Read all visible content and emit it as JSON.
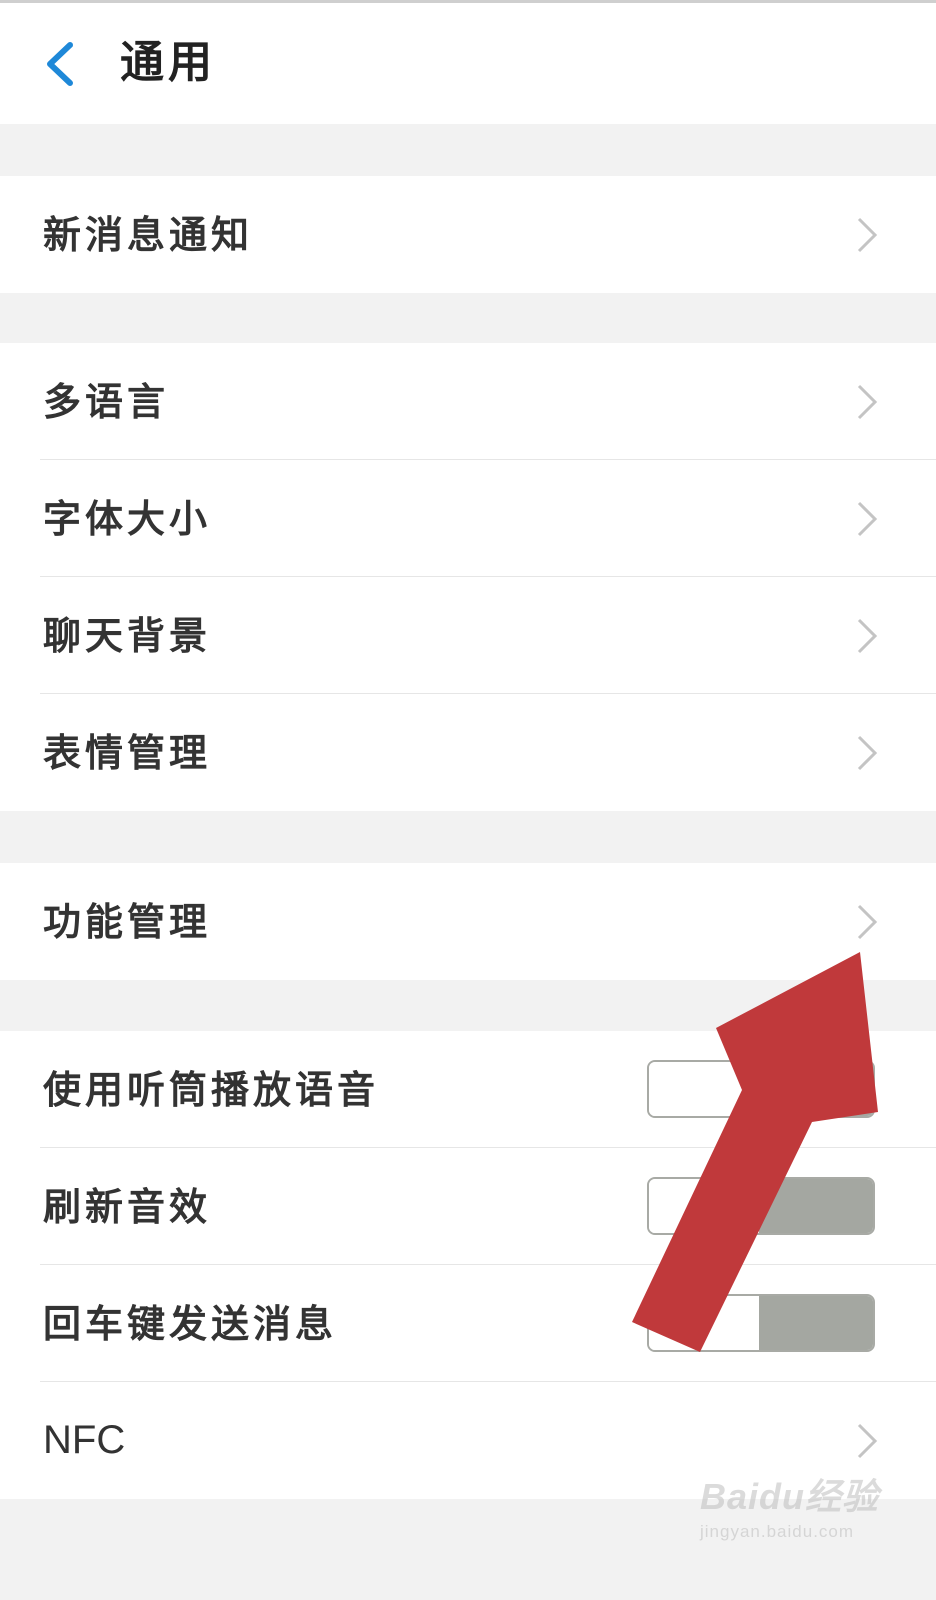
{
  "header": {
    "title": "通用",
    "back_icon": "chevron-left-icon",
    "accent_color": "#1e88d8"
  },
  "groups": [
    {
      "items": [
        {
          "label": "新消息通知",
          "type": "nav"
        }
      ]
    },
    {
      "items": [
        {
          "label": "多语言",
          "type": "nav"
        },
        {
          "label": "字体大小",
          "type": "nav"
        },
        {
          "label": "聊天背景",
          "type": "nav"
        },
        {
          "label": "表情管理",
          "type": "nav"
        }
      ]
    },
    {
      "items": [
        {
          "label": "功能管理",
          "type": "nav"
        }
      ]
    },
    {
      "items": [
        {
          "label": "使用听筒播放语音",
          "type": "toggle",
          "state": "on"
        },
        {
          "label": "刷新音效",
          "type": "toggle",
          "state": "on"
        },
        {
          "label": "回车键发送消息",
          "type": "toggle",
          "state": "on"
        },
        {
          "label": "NFC",
          "type": "nav"
        }
      ]
    }
  ],
  "overlay": {
    "arrow_color": "#c0393b",
    "arrow_target": "功能管理"
  },
  "watermark": {
    "logo": "Baidu经验",
    "url": "jingyan.baidu.com"
  }
}
